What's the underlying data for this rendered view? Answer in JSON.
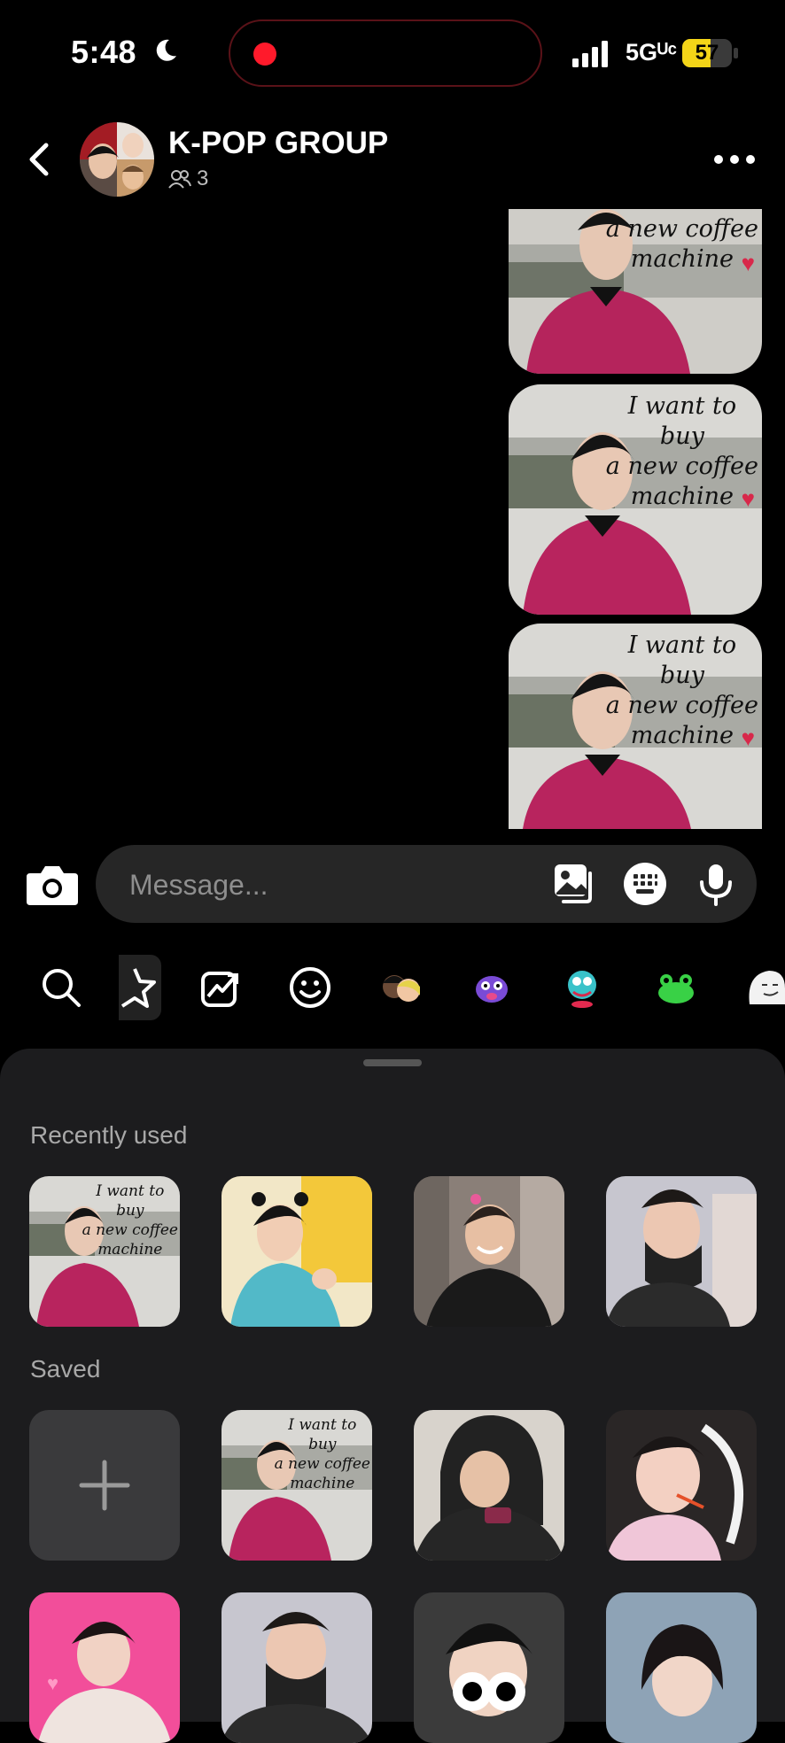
{
  "status_bar": {
    "time": "5:48",
    "network": "5Gᵁᶜ",
    "battery": "57",
    "battery_level": 0.57
  },
  "header": {
    "title": "K-POP GROUP",
    "member_count": "3"
  },
  "sticker_text_lines": [
    "I want to",
    "buy",
    "a new coffee",
    "machine"
  ],
  "composer": {
    "placeholder": "Message..."
  },
  "sticker_tabs": [
    "search-icon",
    "favorites-star-icon",
    "trending-icon",
    "emoji-icon",
    "avatar-pack-icon",
    "purple-monster-pack-icon",
    "green-creature-pack-icon",
    "frog-pack-icon",
    "doodle-pack-icon"
  ],
  "sheet": {
    "recent_label": "Recently used",
    "saved_label": "Saved"
  },
  "sticker_thumb_text": [
    "I want to",
    "buy",
    "a new coffee",
    "machine"
  ]
}
